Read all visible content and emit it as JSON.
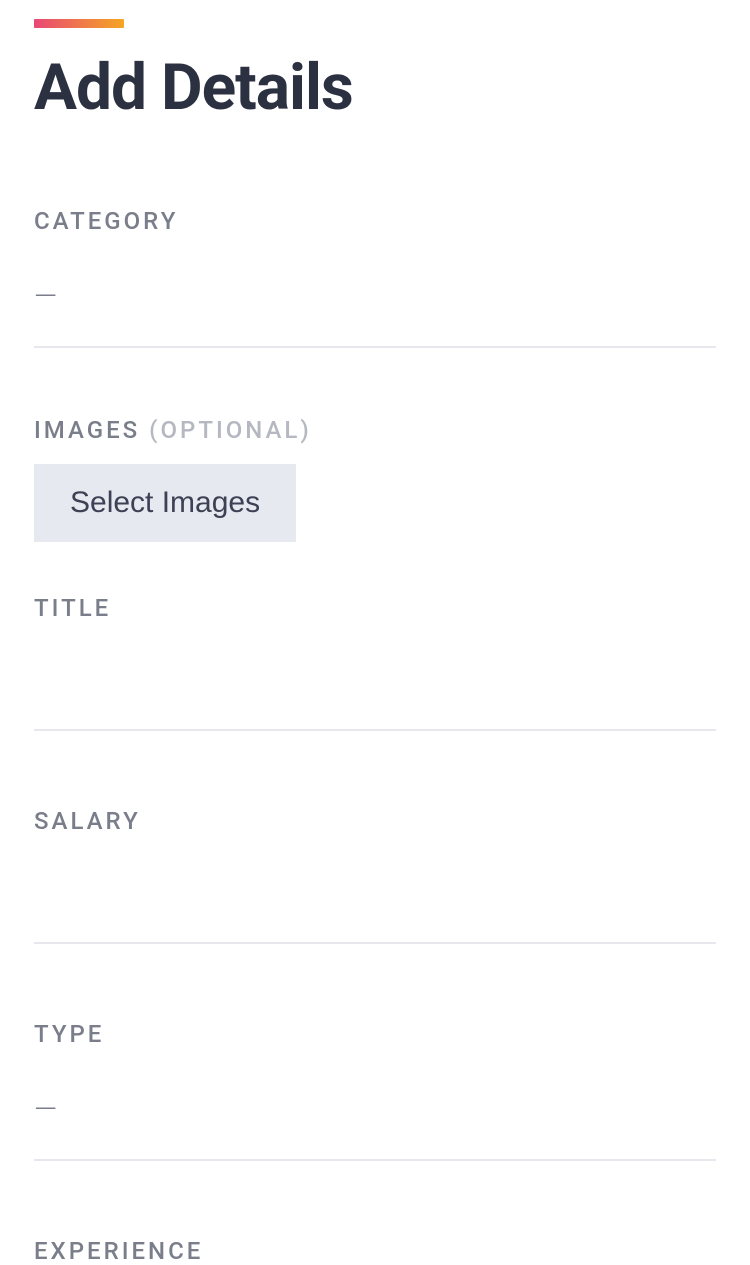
{
  "page": {
    "title": "Add Details"
  },
  "fields": {
    "category": {
      "label": "CATEGORY",
      "value": "",
      "placeholder": "—"
    },
    "images": {
      "label": "IMAGES",
      "optional_label": "(OPTIONAL)",
      "button_label": "Select Images"
    },
    "title": {
      "label": "TITLE",
      "value": ""
    },
    "salary": {
      "label": "SALARY",
      "value": ""
    },
    "type": {
      "label": "TYPE",
      "value": "",
      "placeholder": "—"
    },
    "experience": {
      "label": "EXPERIENCE",
      "value": ""
    }
  }
}
